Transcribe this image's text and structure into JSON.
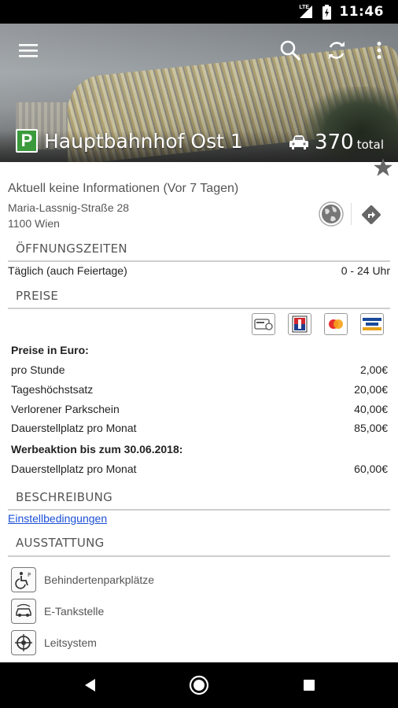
{
  "status_bar": {
    "network_label": "LTE",
    "time": "11:46",
    "icons": [
      "lte-signal-icon",
      "battery-charging-icon"
    ]
  },
  "app_bar": {
    "menu_icon": "hamburger-menu-icon",
    "search_icon": "search-icon",
    "refresh_icon": "refresh-icon",
    "more_icon": "more-vert-icon"
  },
  "garage": {
    "logo_letter": "P",
    "name": "Hauptbahnhof Ost 1",
    "capacity": "370",
    "capacity_unit": "total"
  },
  "info": {
    "status": "Aktuell keine Informationen (Vor 7 Tagen)",
    "street": "Maria-Lassnig-Straße 28",
    "city": "1100 Wien"
  },
  "sections": {
    "hours_title": "ÖFFNUNGSZEITEN",
    "prices_title": "PREISE",
    "description_title": "BESCHREIBUNG",
    "equipment_title": "AUSSTATTUNG"
  },
  "hours": {
    "label": "Täglich (auch Feiertage)",
    "value": "0 - 24 Uhr"
  },
  "payment_methods": [
    "parking-card-icon",
    "maestro-icon",
    "mastercard-icon",
    "visa-icon"
  ],
  "prices": {
    "heading": "Preise in Euro:",
    "rows": [
      {
        "label": "pro Stunde",
        "value": "2,00€"
      },
      {
        "label": "Tageshöchstsatz",
        "value": "20,00€"
      },
      {
        "label": "Verlorener Parkschein",
        "value": "40,00€"
      },
      {
        "label": "Dauerstellplatz pro Monat",
        "value": "85,00€"
      }
    ],
    "promo_heading": "Werbeaktion bis zum 30.06.2018:",
    "promo_rows": [
      {
        "label": "Dauerstellplatz pro Monat",
        "value": "60,00€"
      }
    ]
  },
  "description": {
    "link_text": "Einstellbedingungen"
  },
  "equipment": [
    {
      "label": "Behindertenparkplätze",
      "icon": "wheelchair-icon"
    },
    {
      "label": "E-Tankstelle",
      "icon": "ev-charging-icon"
    },
    {
      "label": "Leitsystem",
      "icon": "guidance-system-icon"
    }
  ],
  "nav_bar": {
    "back_icon": "back-triangle-icon",
    "home_icon": "home-circle-icon",
    "recents_icon": "recents-square-icon"
  },
  "colors": {
    "brand_green": "#3b9a3c",
    "link_blue": "#1a4fd6",
    "divider": "#cfcfcf"
  }
}
